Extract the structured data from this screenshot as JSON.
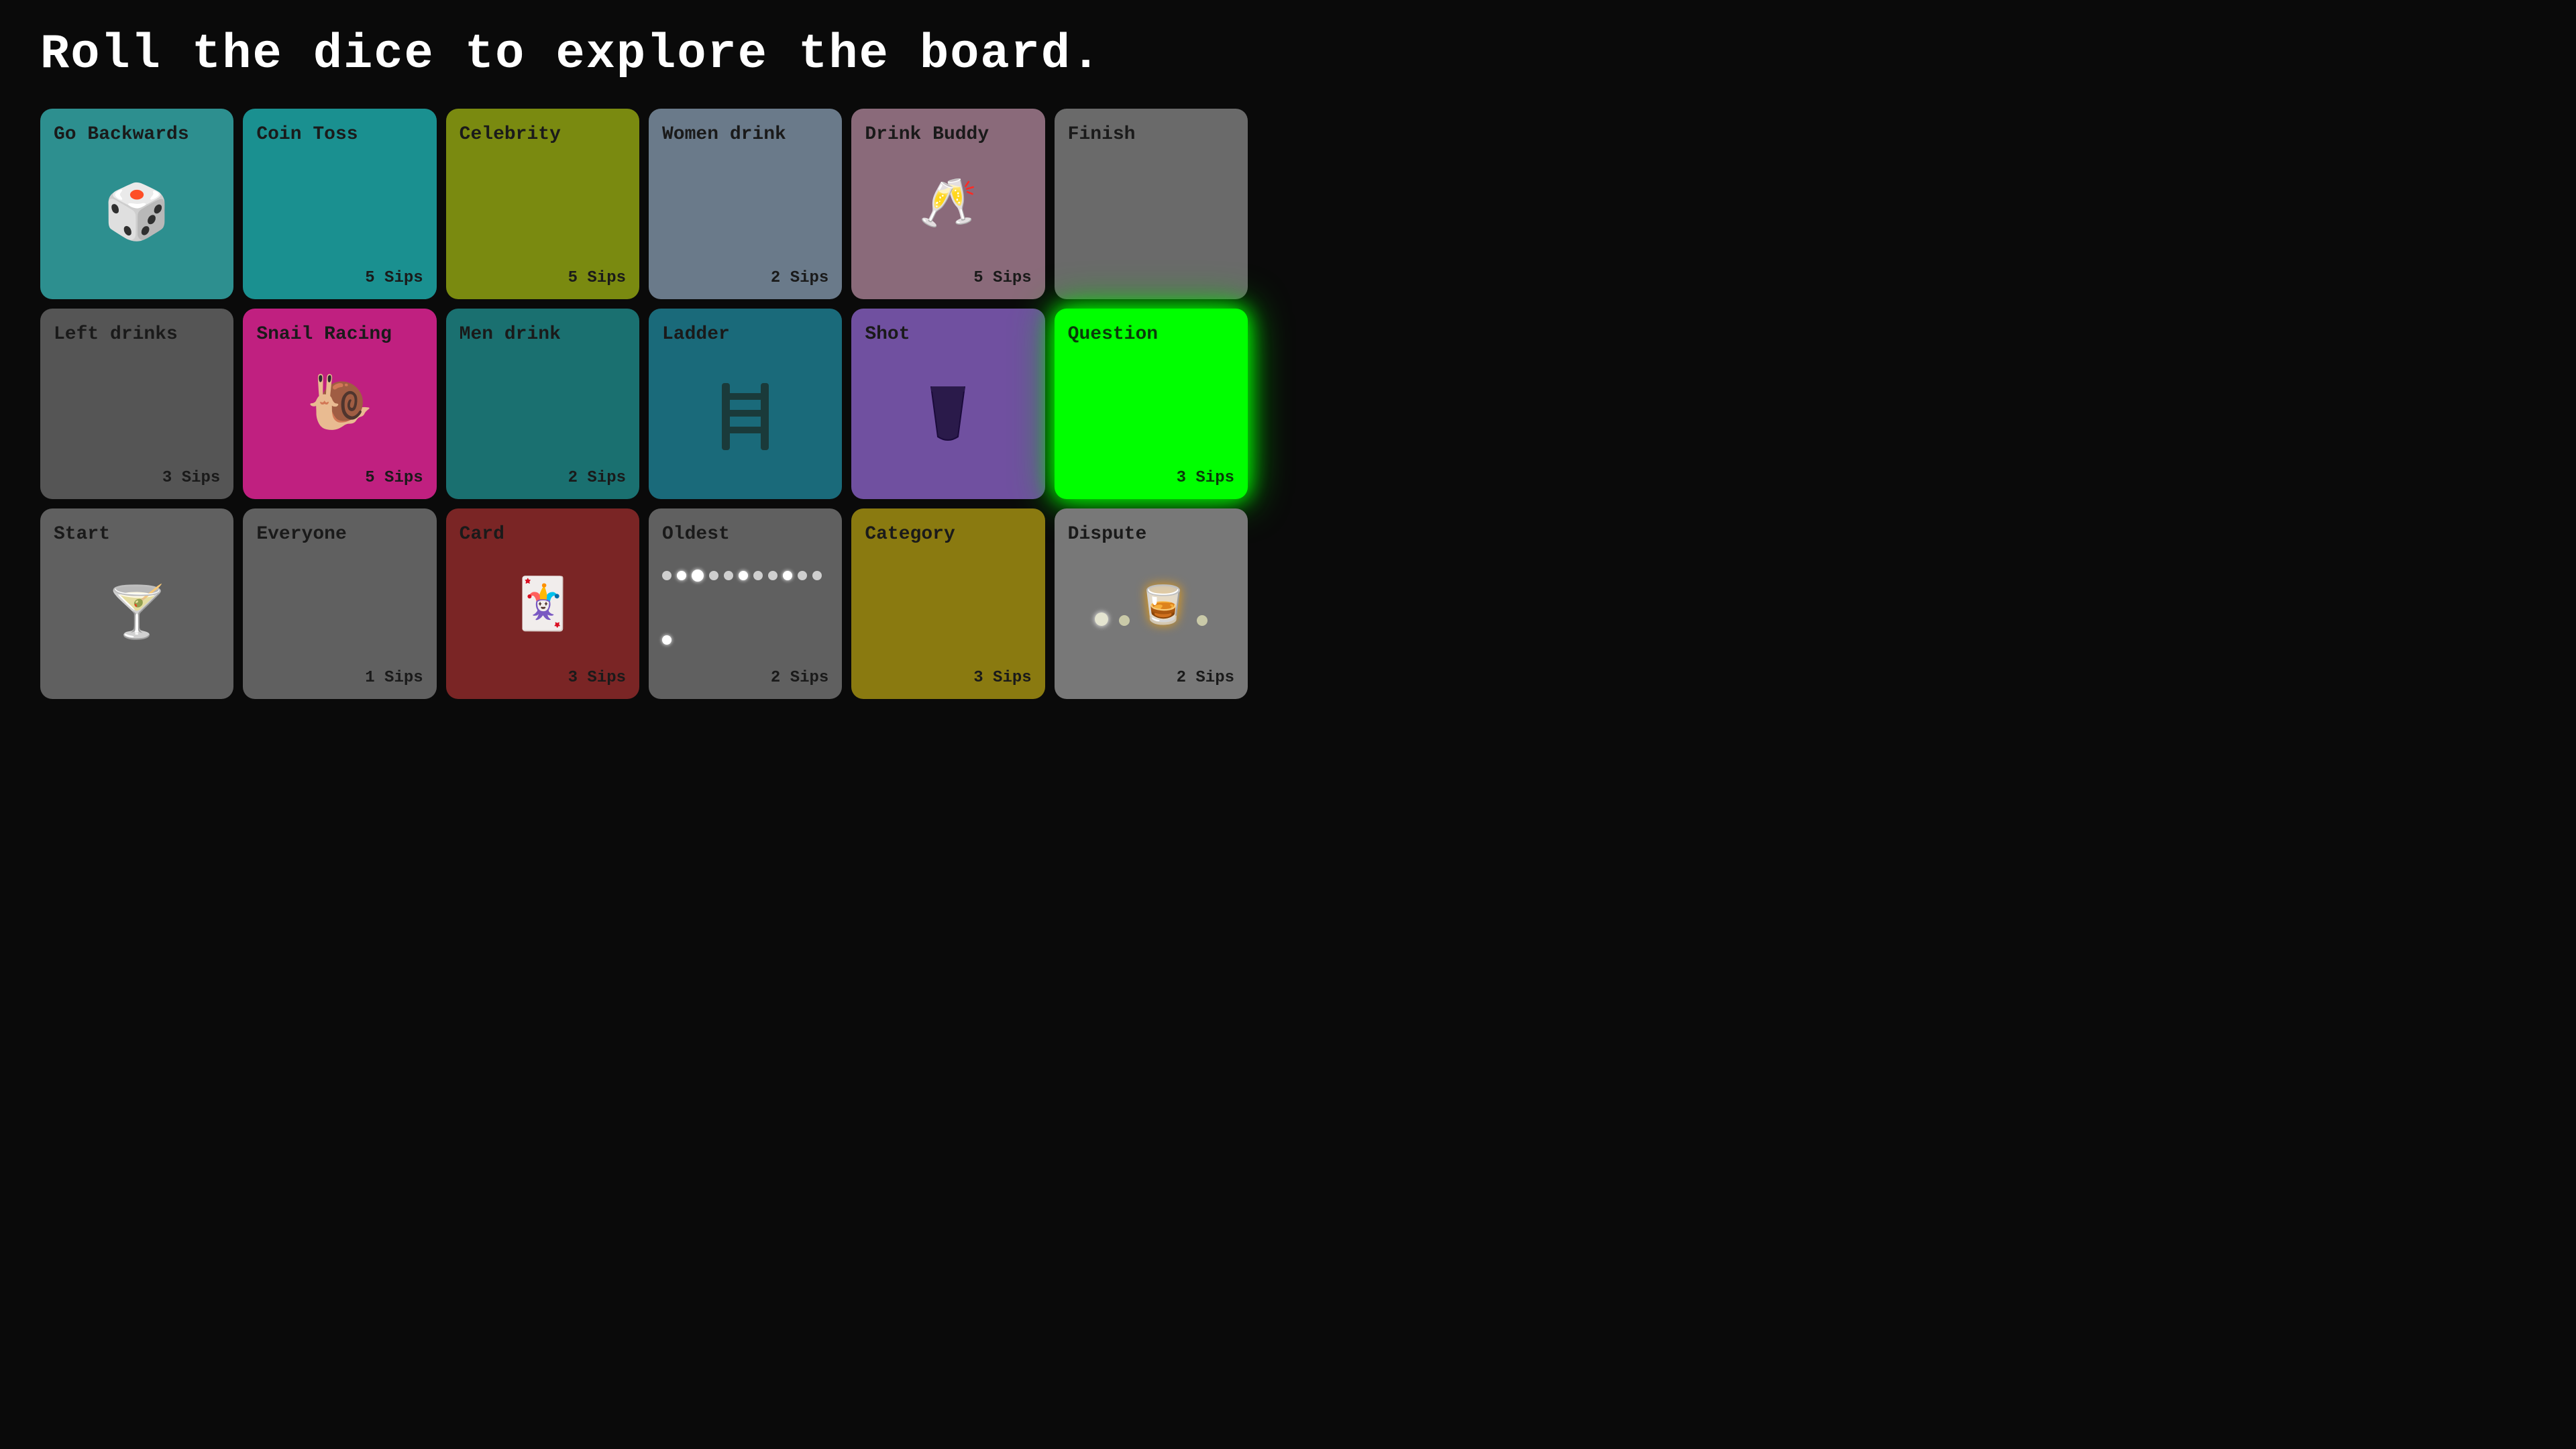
{
  "header": {
    "title": "Roll the dice to explore the board."
  },
  "board": {
    "rows": [
      [
        {
          "id": "go-backwards",
          "title": "Go Backwards",
          "sips": "",
          "icon": "🎲",
          "color": "color-teal"
        },
        {
          "id": "coin-toss",
          "title": "Coin Toss",
          "sips": "5 Sips",
          "icon": "",
          "color": "color-teal2"
        },
        {
          "id": "celebrity",
          "title": "Celebrity",
          "sips": "5 Sips",
          "icon": "",
          "color": "color-olive"
        },
        {
          "id": "women-drink",
          "title": "Women drink",
          "sips": "2 Sips",
          "icon": "",
          "color": "color-gray-blue"
        },
        {
          "id": "drink-buddy",
          "title": "Drink Buddy",
          "sips": "5 Sips",
          "icon": "🥂",
          "color": "color-tan"
        },
        {
          "id": "finish",
          "title": "Finish",
          "sips": "",
          "icon": "",
          "color": "color-gray"
        }
      ],
      [
        {
          "id": "left-drinks",
          "title": "Left drinks",
          "sips": "3 Sips",
          "icon": "",
          "color": "color-dark-gray"
        },
        {
          "id": "snail-racing",
          "title": "Snail Racing",
          "sips": "5 Sips",
          "icon": "🐌",
          "color": "color-pink"
        },
        {
          "id": "men-drink",
          "title": "Men drink",
          "sips": "2 Sips",
          "icon": "",
          "color": "color-teal3"
        },
        {
          "id": "ladder",
          "title": "Ladder",
          "sips": "",
          "icon": "🪜",
          "color": "color-teal-dark"
        },
        {
          "id": "shot",
          "title": "Shot",
          "sips": "",
          "icon": "🥃",
          "color": "color-purple"
        },
        {
          "id": "question",
          "title": "Question",
          "sips": "3 Sips",
          "icon": "",
          "color": "color-green-bright",
          "active": true
        }
      ],
      [
        {
          "id": "start",
          "title": "Start",
          "sips": "",
          "icon": "🍸",
          "color": "color-dark-gray2"
        },
        {
          "id": "everyone",
          "title": "Everyone",
          "sips": "1 Sips",
          "icon": "",
          "color": "color-dark-gray2"
        },
        {
          "id": "card",
          "title": "Card",
          "sips": "3 Sips",
          "icon": "🃏",
          "color": "color-dark-red"
        },
        {
          "id": "oldest",
          "title": "Oldest",
          "sips": "2 Sips",
          "icon": "dots",
          "color": "color-dark-gray2"
        },
        {
          "id": "category",
          "title": "Category",
          "sips": "3 Sips",
          "icon": "",
          "color": "color-gold"
        },
        {
          "id": "dispute",
          "title": "Dispute",
          "sips": "2 Sips",
          "icon": "token",
          "color": "color-gray3"
        }
      ]
    ]
  }
}
